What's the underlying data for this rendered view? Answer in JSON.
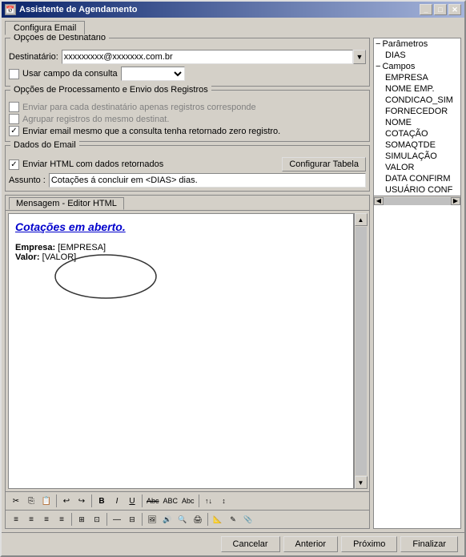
{
  "window": {
    "title": "Assistente de Agendamento",
    "tab": "Configura Email"
  },
  "destinatarios": {
    "legend": "Opções de Destinatário",
    "label": "Destinatário:",
    "value": "xxxxxxxxx@xxxxxxx.com.br",
    "usar_campo_label": "Usar campo da consulta"
  },
  "processamento": {
    "legend": "Opções de Processamento e Envio dos Registros",
    "check1_label": "Enviar para cada destinatário apenas registros corresponde",
    "check2_label": "Agrupar registros do mesmo destinat.",
    "check3_label": "Enviar email mesmo que a consulta tenha retornado zero registro.",
    "check3_checked": true
  },
  "dados_email": {
    "legend": "Dados do Email",
    "html_label": "Enviar HTML com dados retornados",
    "configurar_btn": "Configurar Tabela",
    "assunto_label": "Assunto :",
    "assunto_value": "Cotações á concluir em <DIAS> dias."
  },
  "editor": {
    "tab_label": "Mensagem - Editor HTML",
    "title": "Cotações em aberto.",
    "empresa_label": "Empresa:",
    "empresa_value": "[EMPRESA]",
    "valor_label": "Valor:",
    "valor_value": "[VALOR]"
  },
  "toolbar1": {
    "buttons": [
      "✂",
      "📋",
      "📄",
      "↩",
      "↪",
      "B",
      "I",
      "U",
      "Abc",
      "ABC",
      "Abc",
      "↑↓",
      "↕"
    ]
  },
  "toolbar2": {
    "buttons": [
      "≡",
      "≡",
      "≡",
      "≡",
      "⊞",
      "⊡",
      "—",
      "⊟",
      "🖼",
      "🔊",
      "🔍",
      "🖨",
      "📐",
      "✎",
      "📎"
    ]
  },
  "parametros": {
    "header": "Parâmetros",
    "dias": "DIAS",
    "campos_header": "Campos",
    "fields": [
      "EMPRESA",
      "NOME EMP.",
      "CONDICAO_SIM",
      "FORNECEDOR",
      "NOME",
      "COTAÇÃO",
      "SOMAQTDE",
      "SIMULAÇÃO",
      "VALOR",
      "DATA CONFIRM",
      "USUÁRIO CONF"
    ]
  },
  "bottom_buttons": {
    "cancelar": "Cancelar",
    "anterior": "Anterior",
    "proximo": "Próximo",
    "finalizar": "Finalizar"
  }
}
